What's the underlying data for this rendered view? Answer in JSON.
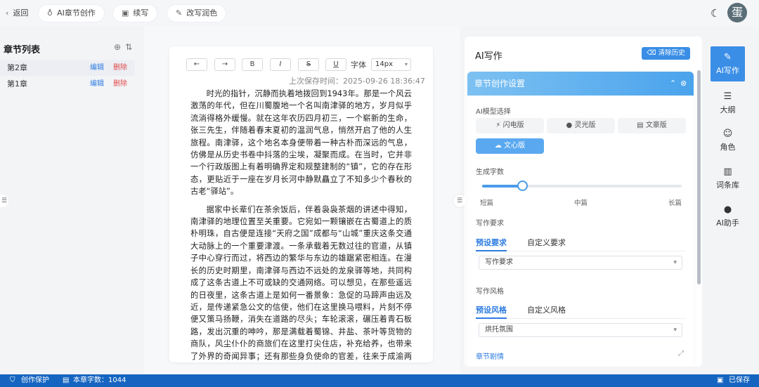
{
  "topbar": {
    "back": "返回",
    "ai_create": "AI章节创作",
    "continue": "续写",
    "rewrite": "改写润色",
    "avatar": "蛋"
  },
  "chapters": {
    "title": "章节列表",
    "items": [
      {
        "name": "第2章",
        "edit": "编辑",
        "delete": "删除"
      },
      {
        "name": "第1章",
        "edit": "编辑",
        "delete": "删除"
      }
    ]
  },
  "editor": {
    "toolbar": {
      "undo": "←",
      "redo": "→",
      "bold": "B",
      "italic": "I",
      "strike": "S",
      "underline": "U",
      "font_label": "字体",
      "font_size": "14px"
    },
    "saved_time": "上次保存时间：2025-09-26 18:36:47",
    "paragraphs": [
      "时光的指针，沉静而执着地拨回到1943年。那是一个风云激荡的年代，但在川蜀腹地一个名叫南津驿的地方，岁月似乎流淌得格外缓慢。就在这年农历四月初三，一个崭新的生命，张三先生，伴随着春末夏初的温润气息，悄然开启了他的人生旅程。南津驿，这个地名本身便带着一种古朴而深远的气息，仿佛是从历史书卷中抖落的尘埃，凝聚而成。在当时，它并非一个行政版图上有着明确界定和规整建制的“镇”，它的存在形态，更贴近于一座在岁月长河中静默矗立了不知多少个春秋的古老“驿站”。",
      "据家中长辈们在茶余饭后，伴着袅袅茶烟的讲述中得知，南津驿的地理位置至关重要。它宛如一颗镶嵌在古蜀道上的质朴明珠，自古便是连接“天府之国”成都与“山城”重庆这条交通大动脉上的一个重要津渡。一条承载着无数过往的官道，从镇子中心穿行而过，将西边的繁华与东边的雄踞紧密相连。在漫长的历史时期里，南津驿与西边不远处的龙泉驿等地，共同构成了这条古道上不可或缺的交通网络。可以想见，在那些遥远的日夜里，这条古道上是如何一番景象：急促的马蹄声由远及近，是传递紧急公文的信使，他们在这里换马喂料，片刻不停便又策马扬鞭，消失在道路的尽头；车轮滚滚，碾压着青石板路，发出沉重的呻吟，那是满载着蜀锦、井盐、茶叶等货物的商队，风尘仆仆的商旅们在这里打尖住店，补充给养，也带来了外界的奇闻异事；还有那些身负使命的官差，往来于成渝两地，他们的短暂驻留，为这个小小的驿站带来了权威与秩序。无数行色匆匆的过客，都在此地留下了或深或浅的印迹，他们"
    ]
  },
  "ai_panel": {
    "title": "AI写作",
    "clear_history": "清除历史",
    "card_title": "章节创作设置",
    "model_label": "AI模型选择",
    "models": [
      "闪电版",
      "灵光版",
      "文豪版",
      "文心版"
    ],
    "selected_model": "文心版",
    "length_label": "生成字数",
    "length_value": 0.2,
    "length_ticks": [
      "短篇",
      "中篇",
      "长篇"
    ],
    "requirement_label": "写作要求",
    "requirement_tabs": [
      "预设要求",
      "自定义要求"
    ],
    "requirement_select": "写作要求",
    "style_label": "写作风格",
    "style_tabs": [
      "预设风格",
      "自定义风格"
    ],
    "style_select": "烘托氛围",
    "plot_label": "章节剧情"
  },
  "rail": {
    "items": [
      {
        "label": "AI写作",
        "icon": "pen-icon"
      },
      {
        "label": "大纲",
        "icon": "outline-icon"
      },
      {
        "label": "角色",
        "icon": "user-icon"
      },
      {
        "label": "词条库",
        "icon": "book-icon"
      },
      {
        "label": "AI助手",
        "icon": "chat-icon"
      }
    ]
  },
  "status": {
    "protect": "创作保护",
    "word_count": "本章字数：1044",
    "saved": "已保存"
  },
  "colors": {
    "accent": "#3a8ee6",
    "status_bar": "#1565c0",
    "delete": "#e14b4b"
  }
}
